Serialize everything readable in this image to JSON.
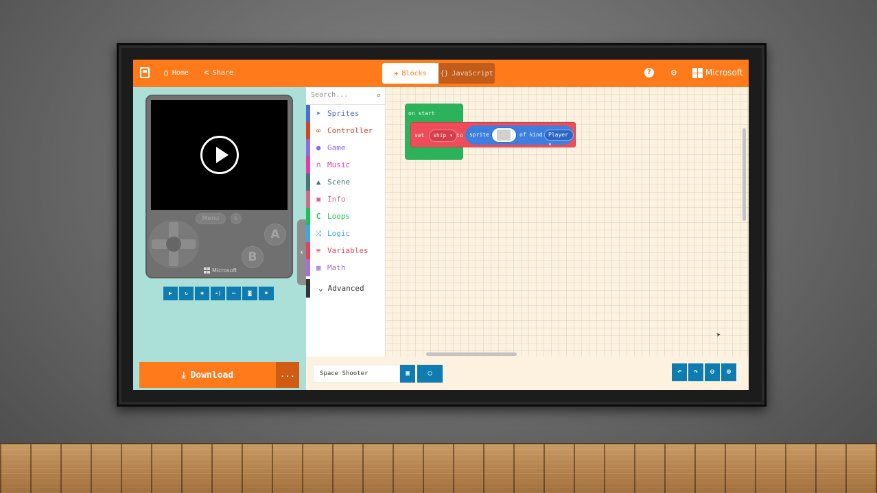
{
  "topbar": {
    "home_label": "Home",
    "share_label": "Share",
    "tabs": [
      {
        "label": "Blocks",
        "icon": "puzzle-icon",
        "active": true
      },
      {
        "label": "JavaScript",
        "icon": "braces-icon",
        "active": false
      }
    ],
    "brand": "Microsoft"
  },
  "simulator": {
    "menu_label": "Menu",
    "button_a": "A",
    "button_b": "B",
    "brand": "Microsoft",
    "tools": [
      "play-icon",
      "restart-icon",
      "debug-icon",
      "mute-icon",
      "keyboard-icon",
      "screenshot-icon",
      "fullscreen-icon"
    ]
  },
  "download": {
    "label": "Download",
    "more_label": "..."
  },
  "toolbox": {
    "search_placeholder": "Search...",
    "categories": [
      {
        "label": "Sprites",
        "color": "#4b6cd0",
        "icon": "paper-plane-icon"
      },
      {
        "label": "Controller",
        "color": "#d54322",
        "icon": "gamepad-icon"
      },
      {
        "label": "Game",
        "color": "#8f6ae8",
        "icon": "circle-icon"
      },
      {
        "label": "Music",
        "color": "#e63aa9",
        "icon": "headphones-icon"
      },
      {
        "label": "Scene",
        "color": "#4b7277",
        "icon": "tree-icon"
      },
      {
        "label": "Info",
        "color": "#cf6a87",
        "icon": "id-card-icon"
      },
      {
        "label": "Loops",
        "color": "#20bf55",
        "icon": "loop-icon"
      },
      {
        "label": "Logic",
        "color": "#3da5e8",
        "icon": "shuffle-icon"
      },
      {
        "label": "Variables",
        "color": "#e0455b",
        "icon": "list-icon"
      },
      {
        "label": "Math",
        "color": "#a66ddb",
        "icon": "calculator-icon"
      }
    ],
    "advanced_label": "Advanced"
  },
  "workspace": {
    "on_start": "on start",
    "set_word": "set",
    "variable": "ship",
    "to_word": "to",
    "sprite_word": "sprite",
    "of_kind": "of kind",
    "kind": "Player"
  },
  "bottombar": {
    "project_name": "Space Shooter"
  }
}
